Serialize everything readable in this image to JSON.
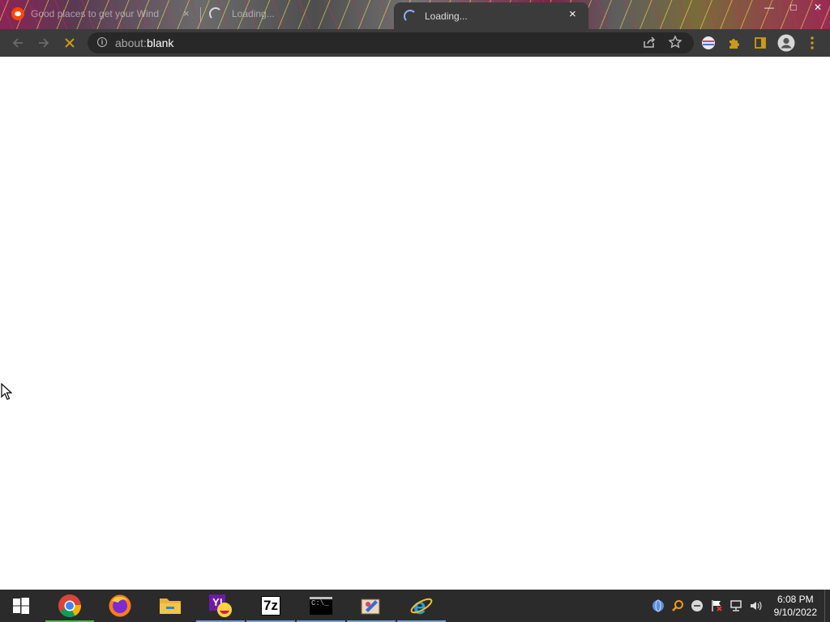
{
  "browser": {
    "tabs": [
      {
        "title": "Good places to get your Wind",
        "icon": "reddit-icon",
        "close": "×"
      },
      {
        "title": "Loading...",
        "icon": "loading-spinner-icon"
      },
      {
        "title": "Loading...",
        "icon": "loading-spinner-icon",
        "active": true,
        "close": "×"
      }
    ],
    "window_controls": {
      "minimize": "—",
      "maximize": "□",
      "close": "✕"
    },
    "toolbar": {
      "url_scheme": "about:",
      "url_path": "blank",
      "icons": [
        "back-arrow-icon",
        "forward-arrow-icon",
        "stop-loading-icon",
        "site-info-icon",
        "share-icon",
        "bookmark-star-icon",
        "extension-flag-icon",
        "extensions-puzzle-icon",
        "side-panel-icon",
        "profile-avatar-icon",
        "menu-kebab-icon"
      ]
    }
  },
  "page": {
    "content": ""
  },
  "taskbar": {
    "apps": [
      "start",
      "chrome",
      "firefox",
      "file-explorer",
      "yahoo-messenger",
      "7-zip",
      "command-prompt",
      "paint-tool",
      "internet-explorer"
    ],
    "seven_zip_label": "7z",
    "cmd_label": "C:\\_",
    "clock": {
      "time": "6:08 PM",
      "date": "9/10/2022"
    },
    "tray_icons": [
      "globe-network-icon",
      "search-magnifier-icon",
      "minus-circle-icon",
      "flag-notification-icon",
      "network-icon",
      "speaker-icon"
    ]
  },
  "colors": {
    "tab_strip_dark": "#3b3b3b",
    "omnibox": "#282828",
    "taskbar": "#2b2b2b",
    "accent": "#8ab4f8",
    "loading_spinner": "#c99a1c"
  }
}
